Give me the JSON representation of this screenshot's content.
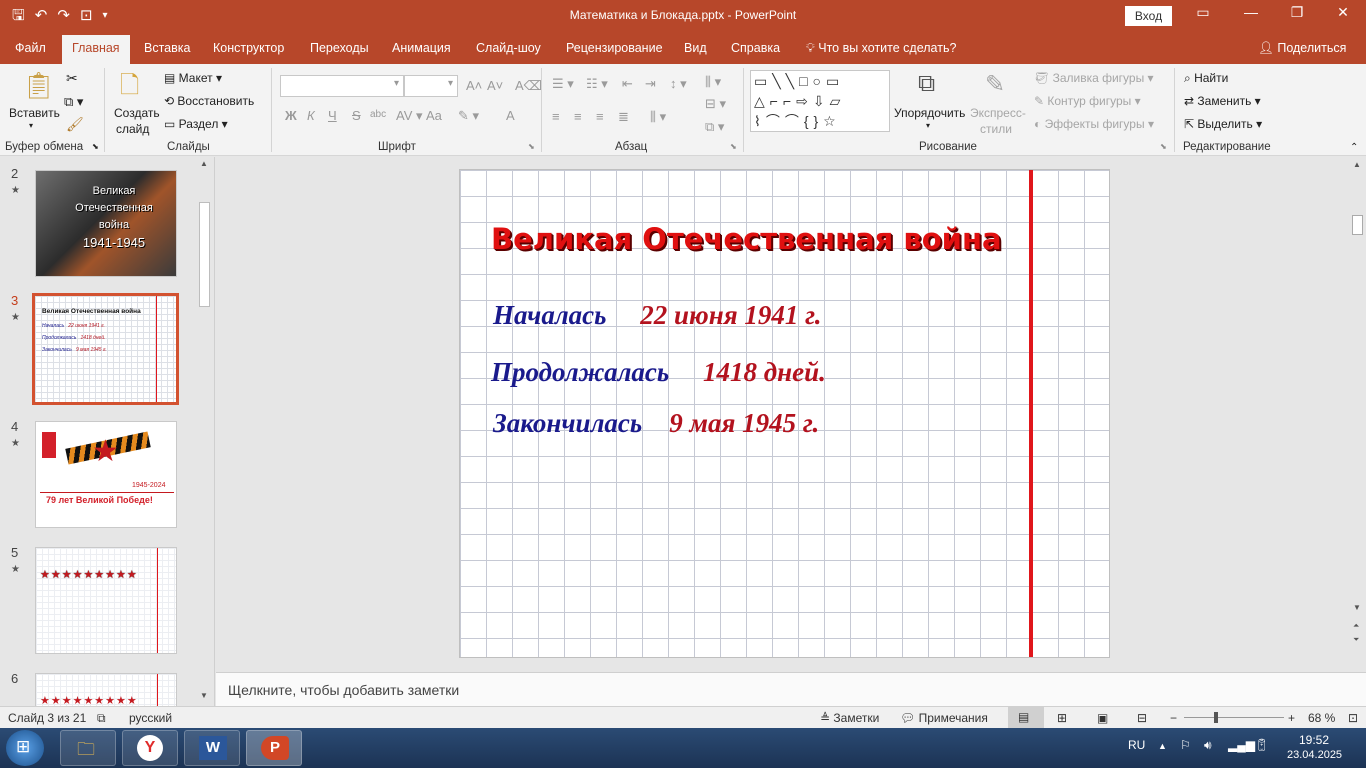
{
  "window": {
    "title": "Математика и Блокада.pptx  -  PowerPoint",
    "signin": "Вход",
    "minimize": "—",
    "restore": "❐",
    "close": "✕"
  },
  "tabs": [
    "Файл",
    "Главная",
    "Вставка",
    "Конструктор",
    "Переходы",
    "Анимация",
    "Слайд-шоу",
    "Рецензирование",
    "Вид",
    "Справка"
  ],
  "tell_me": "Что вы хотите сделать?",
  "share": "Поделиться",
  "ribbon": {
    "clipboard": {
      "label": "Буфер обмена",
      "paste": "Вставить"
    },
    "slides": {
      "label": "Слайды",
      "new_slide_1": "Создать",
      "new_slide_2": "слайд",
      "layout": "Макет",
      "reset": "Восстановить",
      "section": "Раздел"
    },
    "font": {
      "label": "Шрифт",
      "bold": "Ж",
      "italic": "К",
      "underline": "Ч",
      "strike": "S",
      "abc": "abc",
      "aa": "Aa",
      "a_color": "A"
    },
    "paragraph": {
      "label": "Абзац"
    },
    "drawing": {
      "label": "Рисование",
      "arrange_1": "Упорядочить",
      "quick_styles_1": "Экспресс-",
      "quick_styles_2": "стили",
      "fill": "Заливка фигуры",
      "outline": "Контур фигуры",
      "effects": "Эффекты фигуры"
    },
    "editing": {
      "label": "Редактирование",
      "find": "Найти",
      "replace": "Заменить",
      "select": "Выделить"
    }
  },
  "thumbnails": [
    {
      "num": "2",
      "star": "★"
    },
    {
      "num": "3",
      "star": "★",
      "line1": "Великая Отечественная война",
      "a": "Началась",
      "b": "22 июня 1941 г.",
      "c": "Продолжалась",
      "d": "1418 дней.",
      "e": "Закончилась",
      "f": "9 мая 1945 г."
    },
    {
      "num": "4",
      "star": "★",
      "text": "79 лет  Великой  Победе!",
      "years": "1945-2024"
    },
    {
      "num": "5",
      "star": "★"
    },
    {
      "num": "6"
    }
  ],
  "thumb2_text": {
    "l1": "Великая",
    "l2": "Отечественная",
    "l3": "война",
    "l4": "1941-1945"
  },
  "slide": {
    "title": "Великая Отечественная война",
    "rows": [
      {
        "label": "Началась",
        "value": "22 июня 1941 г."
      },
      {
        "label": "Продолжалась",
        "value": "1418 дней."
      },
      {
        "label": "Закончилась",
        "value": "9 мая 1945 г."
      }
    ]
  },
  "notes_placeholder": "Щелкните, чтобы добавить заметки",
  "status": {
    "slide": "Слайд 3 из 21",
    "lang": "русский",
    "notes": "Заметки",
    "comments": "Примечания",
    "zoom": "68 %"
  },
  "taskbar": {
    "lang": "RU",
    "time": "19:52",
    "date": "23.04.2025"
  },
  "colors": {
    "accent": "#b7472a",
    "title_red": "#e01010",
    "label_blue": "#1a1a8c",
    "value_red": "#b3121e"
  }
}
